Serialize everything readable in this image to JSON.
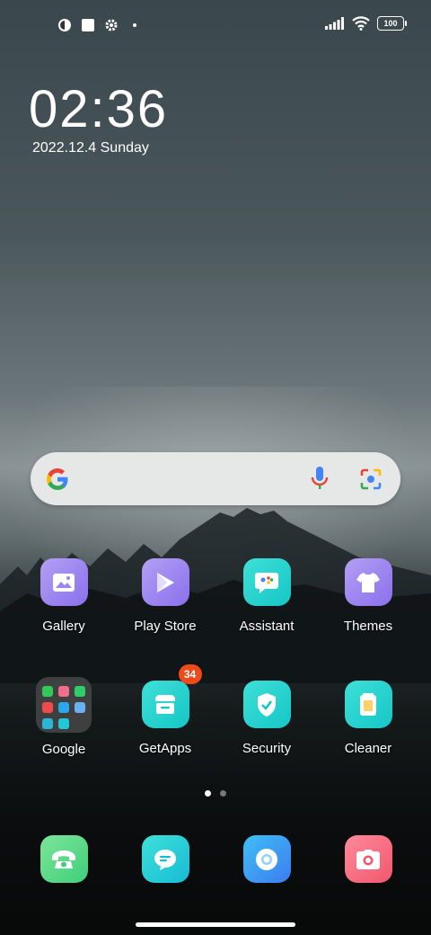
{
  "status_bar": {
    "left_icons": [
      "face-app-icon",
      "square-notification-icon",
      "gear-icon",
      "dot-icon"
    ],
    "right_icons": [
      "signal-icon",
      "wifi-icon"
    ],
    "battery": "100"
  },
  "clock": {
    "time": "02:36",
    "date": "2022.12.4 Sunday"
  },
  "search_bar": {
    "icons": [
      "google-logo",
      "mic-icon",
      "lens-icon"
    ]
  },
  "apps_row1": [
    {
      "label": "Gallery",
      "icon": "gallery-icon",
      "color": "#9b86f0"
    },
    {
      "label": "Play Store",
      "icon": "play-store-icon",
      "color": "#9b86f0"
    },
    {
      "label": "Assistant",
      "icon": "assistant-icon",
      "color": "#1fd1cf"
    },
    {
      "label": "Themes",
      "icon": "themes-icon",
      "color": "#9b86f0"
    }
  ],
  "apps_row2": [
    {
      "label": "Google",
      "icon": "google-folder-icon"
    },
    {
      "label": "GetApps",
      "icon": "getapps-icon",
      "badge": "34",
      "color": "#1fd1cf"
    },
    {
      "label": "Security",
      "icon": "security-icon",
      "color": "#1fd1cf"
    },
    {
      "label": "Cleaner",
      "icon": "cleaner-icon",
      "color": "#1fd1cf"
    }
  ],
  "dock": [
    {
      "icon": "phone-icon",
      "color": "#5fd98a"
    },
    {
      "icon": "messages-icon",
      "color": "#1fc8d6"
    },
    {
      "icon": "browser-icon",
      "color": "#29a8f0"
    },
    {
      "icon": "camera-icon",
      "color": "#f2667a"
    }
  ],
  "pager": {
    "pages": 2,
    "current": 1
  }
}
